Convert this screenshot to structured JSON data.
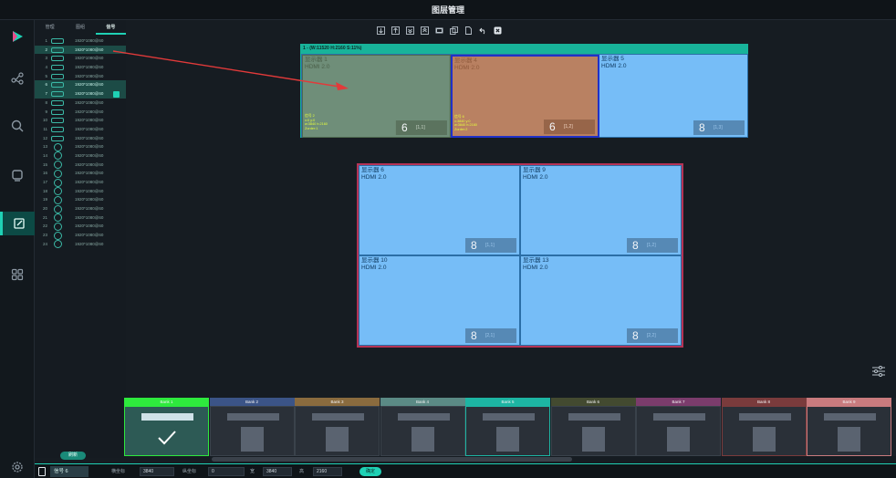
{
  "window": {
    "title": "图层管理"
  },
  "nav": [
    "play-logo",
    "topology-icon",
    "search-icon",
    "monitor-icon",
    "edit-icon",
    "apps-icon",
    "settings-icon"
  ],
  "signal_panel": {
    "tabs": [
      "管理",
      "图组",
      "信号"
    ],
    "rows": [
      {
        "num": "1",
        "res": "1920*1080@60"
      },
      {
        "num": "2",
        "res": "1920*1080@60"
      },
      {
        "num": "3",
        "res": "1920*1080@60"
      },
      {
        "num": "4",
        "res": "1920*1080@60"
      },
      {
        "num": "5",
        "res": "1920*1080@60"
      },
      {
        "num": "6",
        "res": "1920*1080@60"
      },
      {
        "num": "7",
        "res": "1920*1080@60"
      },
      {
        "num": "8",
        "res": "1920*1080@60"
      },
      {
        "num": "9",
        "res": "1920*1080@60"
      },
      {
        "num": "10",
        "res": "1920*1080@60"
      },
      {
        "num": "11",
        "res": "1920*1080@60"
      },
      {
        "num": "12",
        "res": "1920*1080@60"
      },
      {
        "num": "13",
        "res": "1920*1080@60"
      },
      {
        "num": "14",
        "res": "1920*1080@60"
      },
      {
        "num": "15",
        "res": "1920*1080@60"
      },
      {
        "num": "16",
        "res": "1920*1080@60"
      },
      {
        "num": "17",
        "res": "1920*1080@60"
      },
      {
        "num": "18",
        "res": "1920*1080@60"
      },
      {
        "num": "19",
        "res": "1920*1080@60"
      },
      {
        "num": "20",
        "res": "1920*1080@60"
      },
      {
        "num": "21",
        "res": "1920*1080@60"
      },
      {
        "num": "22",
        "res": "1920*1080@60"
      },
      {
        "num": "23",
        "res": "1920*1080@60"
      },
      {
        "num": "24",
        "res": "1920*1080@60"
      }
    ],
    "refresh_label": "刷新"
  },
  "toolbar": [
    "bring-down-icon",
    "bring-up-icon",
    "bring-bottom-icon",
    "bring-top-icon",
    "fullscreen-icon",
    "copy-icon",
    "paste-icon",
    "undo-icon",
    "close-icon"
  ],
  "wall1": {
    "header": "1 - (W:11520 H:2160 S:11%)",
    "screens": [
      {
        "name": "显示器 1",
        "input": "HDMI 2.0",
        "count": "6",
        "pos": "[1,1]"
      },
      {
        "name": "显示器 4",
        "input": "HDMI 2.0",
        "count": "6",
        "pos": "[1,2]"
      },
      {
        "name": "显示器 5",
        "input": "HDMI 2.0",
        "count": "8",
        "pos": "[1,3]"
      }
    ],
    "windows": [
      {
        "info": [
          "信号 2",
          "x:0  y:0",
          "w:3840  h:2160",
          "Zorder:1"
        ]
      },
      {
        "info": [
          "信号 6",
          "x:3840  y:0",
          "w:3840  h:2160",
          "Zorder:2"
        ]
      }
    ]
  },
  "wall2": {
    "screens": [
      {
        "name": "显示器 6",
        "input": "HDMI 2.0",
        "count": "8",
        "pos": "[1,1]"
      },
      {
        "name": "显示器 9",
        "input": "HDMI 2.0",
        "count": "8",
        "pos": "[1,2]"
      },
      {
        "name": "显示器 10",
        "input": "HDMI 2.0",
        "count": "8",
        "pos": "[2,1]"
      },
      {
        "name": "显示器 13",
        "input": "HDMI 2.0",
        "count": "8",
        "pos": "[2,2]"
      }
    ]
  },
  "banks": [
    {
      "label": "Bank 1",
      "color": "#2eea3d"
    },
    {
      "label": "Bank 2",
      "color": "#3b5487"
    },
    {
      "label": "Bank 3",
      "color": "#8a6b3e"
    },
    {
      "label": "Bank 4",
      "color": "#5b8a85"
    },
    {
      "label": "Bank 5",
      "color": "#1db5a3"
    },
    {
      "label": "Bank 6",
      "color": "#434a30"
    },
    {
      "label": "Bank 7",
      "color": "#7b3c6c"
    },
    {
      "label": "Bank 8",
      "color": "#7a3b3c"
    },
    {
      "label": "Bank 9",
      "color": "#c97b7e"
    }
  ],
  "statusbar": {
    "signal": "信号 6",
    "x_label": "横坐标",
    "x_value": "3840",
    "y_label": "纵坐标",
    "y_value": "0",
    "w_label": "宽",
    "w_value": "3840",
    "h_label": "高",
    "h_value": "2160",
    "confirm_label": "确定"
  },
  "colors": {
    "accent": "#1fd1b5",
    "screen_fill": "#76bdf7",
    "window1": "#6f8a6f",
    "window2": "#bd7d5a",
    "wall1_frame": "#18b39a",
    "wall2_frame": "#b53356",
    "arrow": "#e23a3a"
  }
}
